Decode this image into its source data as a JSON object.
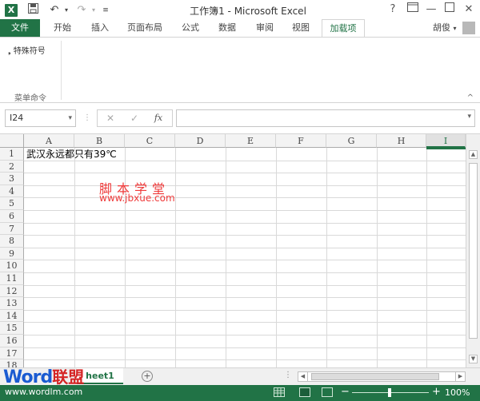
{
  "title_bar": {
    "app_icon_letter": "X",
    "title": "工作簿1 - Microsoft Excel",
    "help": "?",
    "min": "—",
    "close": "✕"
  },
  "ribbon_tabs": [
    "文件",
    "开始",
    "插入",
    "页面布局",
    "公式",
    "数据",
    "审阅",
    "视图",
    "加载项"
  ],
  "active_tab": "加载项",
  "user": "胡俊",
  "ribbon": {
    "item": "特殊符号",
    "group_label": "菜单命令",
    "collapse": "^"
  },
  "formula_bar": {
    "name_box": "I24",
    "cancel": "✕",
    "enter": "✓",
    "fx": "fx",
    "value": ""
  },
  "columns": [
    "A",
    "B",
    "C",
    "D",
    "E",
    "F",
    "G",
    "H",
    "I"
  ],
  "selected_column": "I",
  "rows": [
    "1",
    "2",
    "3",
    "4",
    "5",
    "6",
    "7",
    "8",
    "9",
    "10",
    "11",
    "12",
    "13",
    "14",
    "15",
    "16",
    "17",
    "18"
  ],
  "cells": {
    "A1": "武汉永远都只有39℃"
  },
  "watermark": {
    "name": "脚本学堂",
    "url": "www.jbxue.com"
  },
  "sheet_tabs": [
    "Sheet1"
  ],
  "sheet_tab_visible_text": "heet1",
  "add_sheet": "+",
  "scroll": {
    "left": "◀",
    "right": "▶",
    "up": "▲",
    "down": "▼",
    "dots": "⋮"
  },
  "logo": {
    "word": "Word",
    "cn": "联盟",
    "url": "www.wordlm.com"
  },
  "status": {
    "zoom": "100%",
    "zoom_minus": "−",
    "zoom_plus": "+"
  },
  "colors": {
    "excel_green": "#217346",
    "watermark_red": "#ef3a3a",
    "logo_blue": "#1a5bd1",
    "logo_red": "#d52525"
  }
}
